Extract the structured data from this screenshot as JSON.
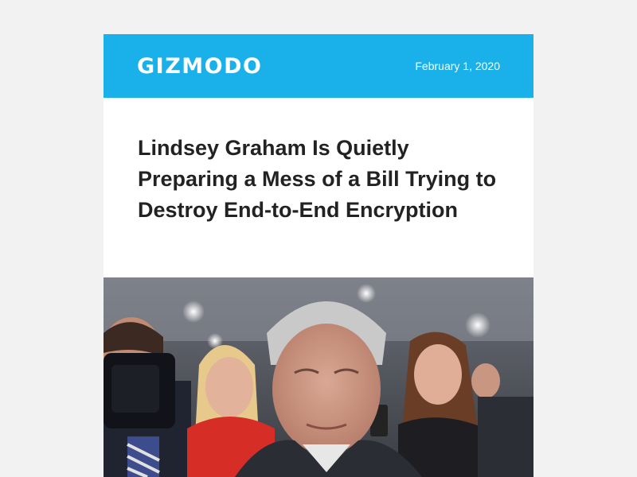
{
  "header": {
    "logo_text": "GIZMODO",
    "date": "February 1, 2020",
    "background_color": "#1ab0ea"
  },
  "article": {
    "headline": "Lindsey Graham Is Quietly Preparing a Mess of a Bill Trying to Destroy End-to-End Encryption",
    "image": "news-photo-senator-surrounded-by-reporters"
  }
}
